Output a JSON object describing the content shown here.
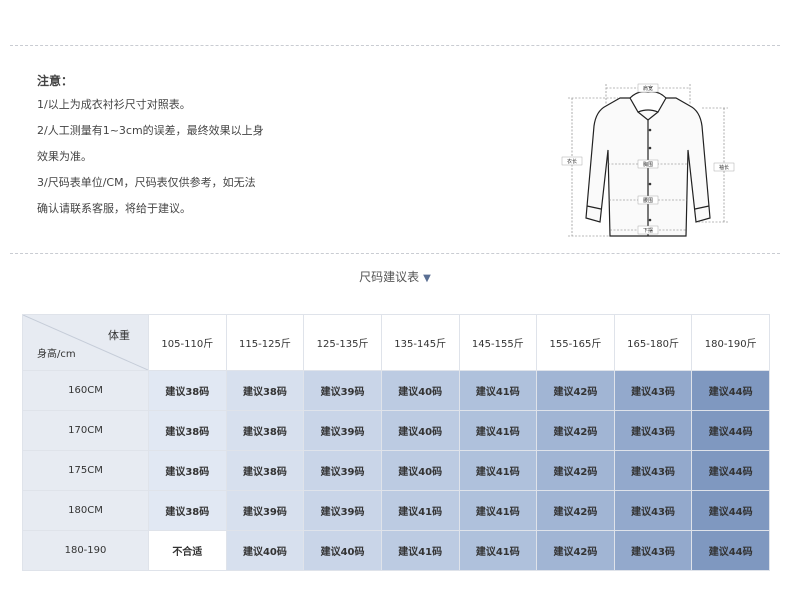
{
  "notes": {
    "title": "注意：",
    "lines": [
      "1/以上为成衣衬衫尺寸对照表。",
      "2/人工测量有1~3cm的误差，最终效果以上身",
      "效果为准。",
      "3/尺码表单位/CM，尺码表仅供参考，如无法",
      "确认请联系客服，将给于建议。"
    ]
  },
  "diagram": {
    "shoulder": "肩宽",
    "length": "衣长",
    "sleeve": "袖长",
    "chest": "胸围",
    "waist": "腰围",
    "hem": "下摆"
  },
  "section_title": "尺码建议表",
  "table": {
    "corner_weight": "体重",
    "corner_height": "身高/cm",
    "columns": [
      "105-110斤",
      "115-125斤",
      "125-135斤",
      "135-145斤",
      "145-155斤",
      "155-165斤",
      "165-180斤",
      "180-190斤"
    ],
    "rows": [
      {
        "height": "160CM",
        "cells": [
          "建议38码",
          "建议38码",
          "建议39码",
          "建议40码",
          "建议41码",
          "建议42码",
          "建议43码",
          "建议44码"
        ]
      },
      {
        "height": "170CM",
        "cells": [
          "建议38码",
          "建议38码",
          "建议39码",
          "建议40码",
          "建议41码",
          "建议42码",
          "建议43码",
          "建议44码"
        ]
      },
      {
        "height": "175CM",
        "cells": [
          "建议38码",
          "建议38码",
          "建议39码",
          "建议40码",
          "建议41码",
          "建议42码",
          "建议43码",
          "建议44码"
        ]
      },
      {
        "height": "180CM",
        "cells": [
          "建议38码",
          "建议39码",
          "建议39码",
          "建议41码",
          "建议41码",
          "建议42码",
          "建议43码",
          "建议44码"
        ]
      },
      {
        "height": "180-190",
        "cells": [
          "不合适",
          "建议40码",
          "建议40码",
          "建议41码",
          "建议41码",
          "建议42码",
          "建议43码",
          "建议44码"
        ]
      }
    ],
    "column_colors": [
      "#e1e8f3",
      "#d7e0ee",
      "#c9d5e8",
      "#bccbe2",
      "#afc1dc",
      "#a1b5d4",
      "#93a9cc",
      "#7f98c0"
    ],
    "unsuitable_color": "#ffffff"
  }
}
